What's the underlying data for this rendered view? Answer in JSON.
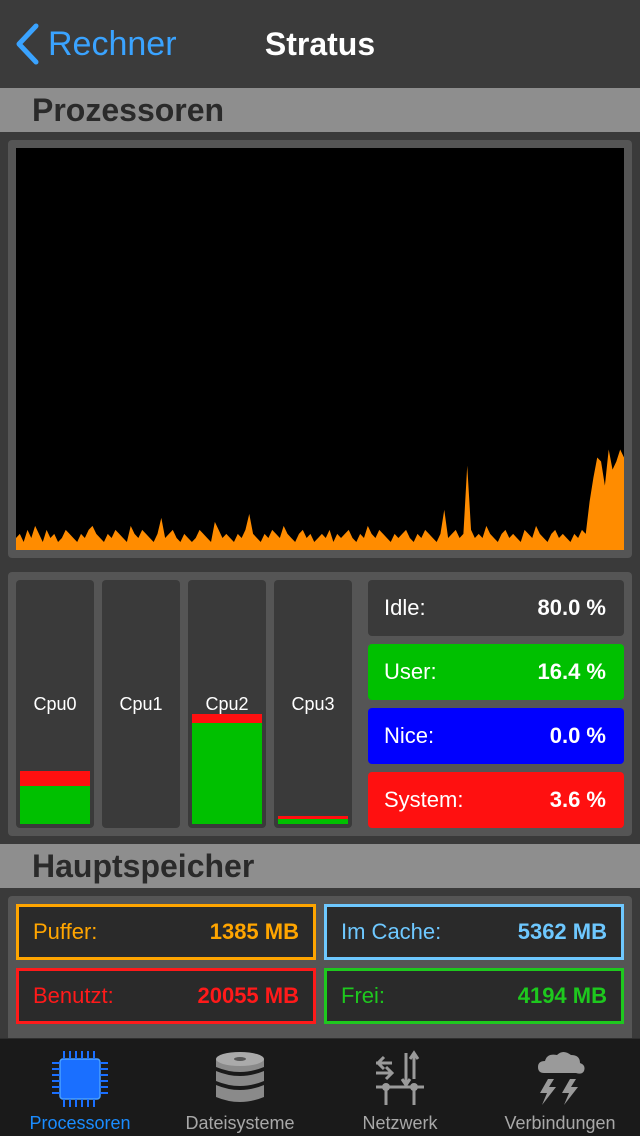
{
  "navbar": {
    "back_label": "Rechner",
    "title": "Stratus"
  },
  "processors": {
    "header": "Prozessoren",
    "cpus": [
      {
        "label": "Cpu0",
        "user": 16,
        "system": 6
      },
      {
        "label": "Cpu1",
        "user": 0,
        "system": 0
      },
      {
        "label": "Cpu2",
        "user": 42,
        "system": 4
      },
      {
        "label": "Cpu3",
        "user": 2,
        "system": 1.5
      }
    ],
    "stats": {
      "idle_label": "Idle:",
      "idle_value": "80.0 %",
      "user_label": "User:",
      "user_value": "16.4 %",
      "nice_label": "Nice:",
      "nice_value": "0.0 %",
      "system_label": "System:",
      "system_value": "3.6 %"
    },
    "colors": {
      "user": "#00c000",
      "nice": "#0000ff",
      "system": "#ff1010",
      "idle": "#3a3a3a",
      "history": "#ff8c00"
    }
  },
  "memory": {
    "header": "Hauptspeicher",
    "puffer_label": "Puffer:",
    "puffer_value": "1385 MB",
    "cache_label": "Im Cache:",
    "cache_value": "5362 MB",
    "used_label": "Benutzt:",
    "used_value": "20055 MB",
    "free_label": "Frei:",
    "free_value": "4194 MB",
    "colors": {
      "puffer": "#ffa500",
      "cache": "#6ec8ff",
      "used": "#ff1a1a",
      "free": "#1ec81e"
    }
  },
  "tabs": [
    {
      "label": "Processoren",
      "icon": "cpu-chip-icon",
      "active": true
    },
    {
      "label": "Dateisysteme",
      "icon": "disk-stack-icon",
      "active": false
    },
    {
      "label": "Netzwerk",
      "icon": "network-icon",
      "active": false
    },
    {
      "label": "Verbindungen",
      "icon": "storm-cloud-icon",
      "active": false
    }
  ],
  "chart_data": {
    "type": "area",
    "series": [
      {
        "values": [
          3,
          4,
          2,
          5,
          3,
          6,
          4,
          2,
          5,
          3,
          4,
          2,
          3,
          5,
          4,
          3,
          2,
          4,
          3,
          5,
          6,
          4,
          3,
          2,
          4,
          3,
          5,
          4,
          3,
          2,
          6,
          4,
          3,
          5,
          4,
          3,
          2,
          4,
          8,
          3,
          4,
          5,
          3,
          2,
          4,
          3,
          2,
          3,
          5,
          4,
          3,
          2,
          7,
          5,
          3,
          4,
          3,
          2,
          4,
          3,
          5,
          9,
          4,
          3,
          2,
          4,
          3,
          5,
          4,
          3,
          6,
          4,
          3,
          2,
          4,
          5,
          3,
          4,
          2,
          3,
          4,
          3,
          5,
          2,
          4,
          3,
          4,
          5,
          3,
          2,
          4,
          3,
          6,
          4,
          3,
          5,
          4,
          3,
          2,
          4,
          3,
          4,
          5,
          3,
          2,
          4,
          3,
          5,
          4,
          3,
          2,
          4,
          10,
          3,
          4,
          5,
          3,
          4,
          21,
          5,
          3,
          4,
          3,
          6,
          4,
          3,
          2,
          4,
          5,
          3,
          4,
          3,
          2,
          5,
          4,
          3,
          6,
          4,
          3,
          2,
          4,
          5,
          3,
          4,
          3,
          2,
          4,
          3,
          5,
          4,
          12,
          18,
          23,
          22,
          16,
          25,
          20,
          22,
          25,
          23
        ]
      }
    ],
    "ylim": [
      0,
      100
    ]
  }
}
